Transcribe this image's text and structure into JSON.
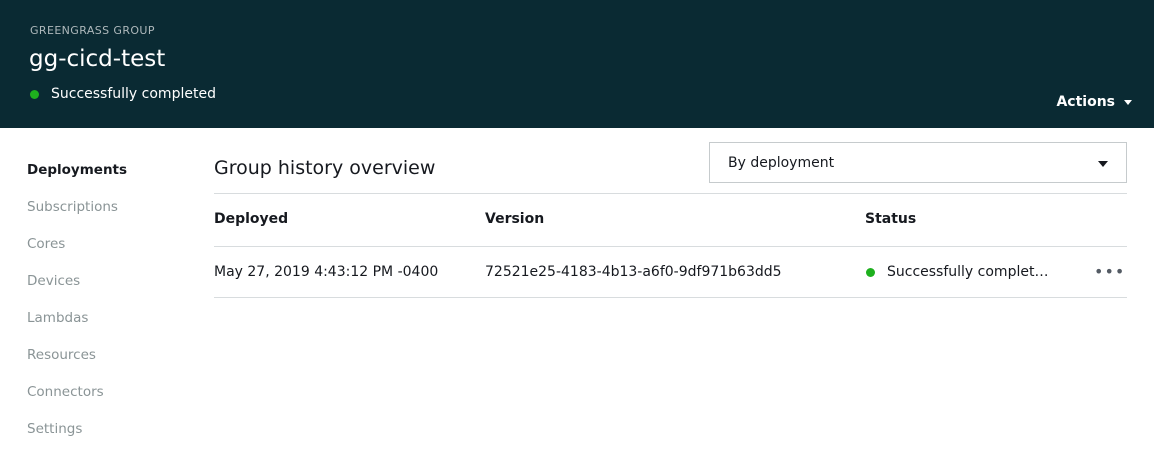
{
  "header": {
    "eyebrow": "GREENGRASS GROUP",
    "group_name": "gg-cicd-test",
    "status": "Successfully completed",
    "actions_label": "Actions"
  },
  "sidebar": {
    "items": [
      {
        "label": "Deployments",
        "active": true
      },
      {
        "label": "Subscriptions",
        "active": false
      },
      {
        "label": "Cores",
        "active": false
      },
      {
        "label": "Devices",
        "active": false
      },
      {
        "label": "Lambdas",
        "active": false
      },
      {
        "label": "Resources",
        "active": false
      },
      {
        "label": "Connectors",
        "active": false
      },
      {
        "label": "Settings",
        "active": false
      }
    ]
  },
  "main": {
    "title": "Group history overview",
    "view_select": "By deployment",
    "table": {
      "columns": [
        "Deployed",
        "Version",
        "Status"
      ],
      "rows": [
        {
          "deployed": "May 27, 2019 4:43:12 PM -0400",
          "version": "72521e25-4183-4b13-a6f0-9df971b63dd5",
          "status": "Successfully complet…",
          "more": "•••"
        }
      ]
    }
  },
  "colors": {
    "header_bg": "#0a2a33",
    "success": "#1eb01e",
    "text": "#16191f",
    "muted": "#8a9496"
  }
}
